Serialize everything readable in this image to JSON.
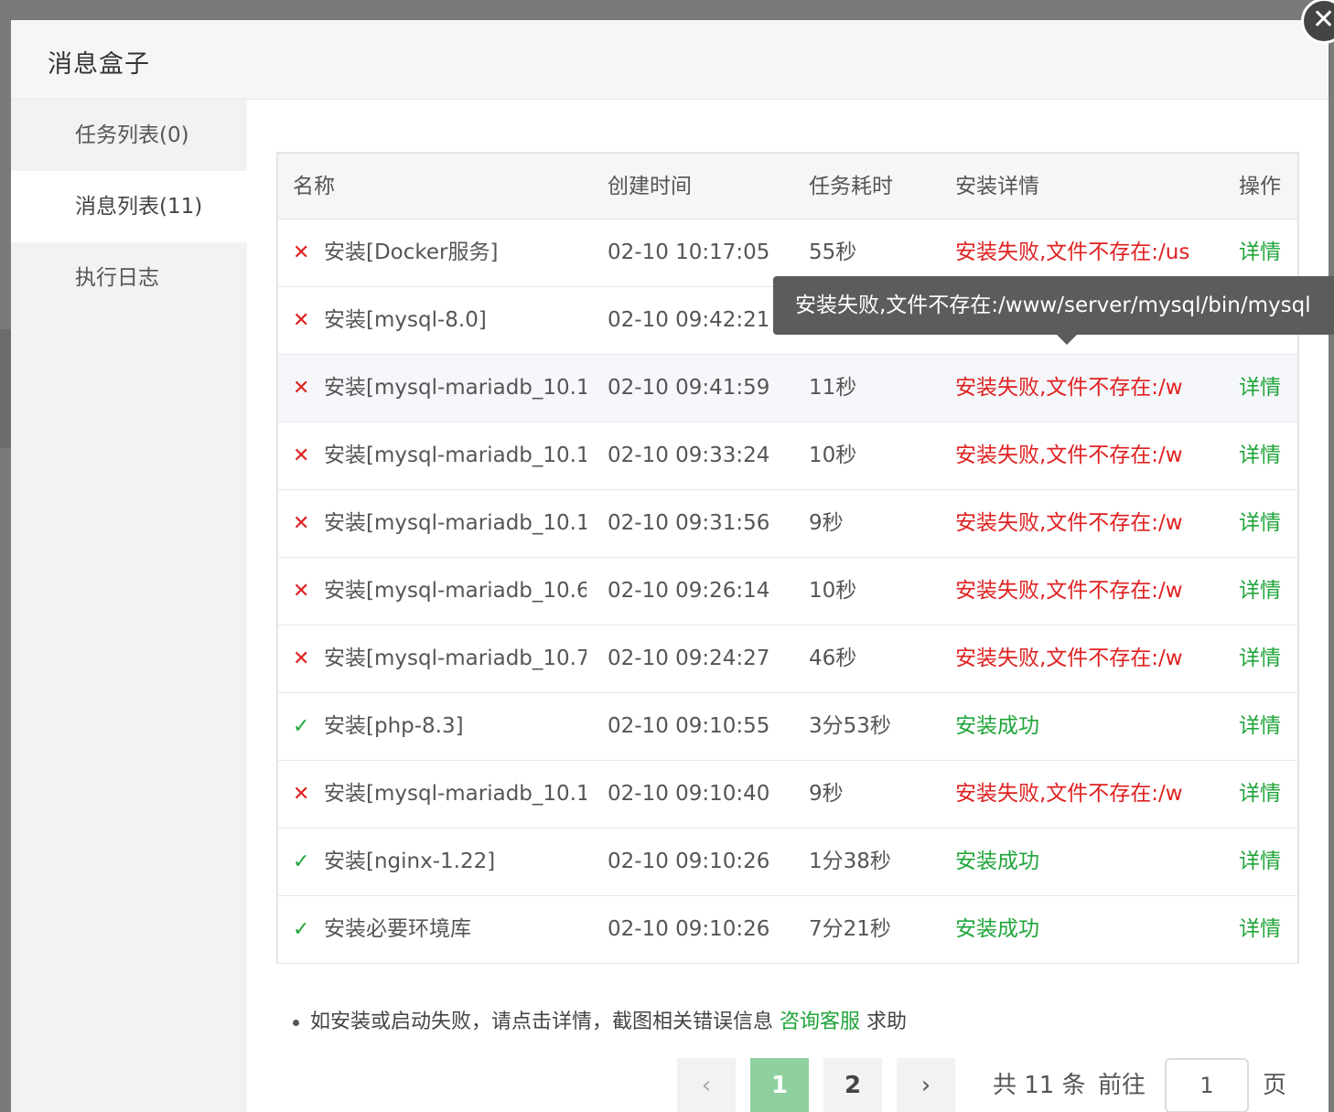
{
  "dialog": {
    "title": "消息盒子",
    "close_glyph": "✕"
  },
  "sidebar": {
    "items": [
      {
        "label": "任务列表(0)"
      },
      {
        "label": "消息列表(11)"
      },
      {
        "label": "执行日志"
      }
    ]
  },
  "table": {
    "headers": {
      "name": "名称",
      "time": "创建时间",
      "duration": "任务耗时",
      "detail": "安装详情",
      "op": "操作"
    },
    "rows": [
      {
        "status": "✕",
        "name": "安装[Docker服务]",
        "time": "02-10 10:17:05",
        "duration": "55秒",
        "detail": "安装失败,文件不存在:/us",
        "op": "详情"
      },
      {
        "status": "✕",
        "name": "安装[mysql-8.0]",
        "time": "02-10 09:42:21",
        "duration": "",
        "detail": "",
        "op": ""
      },
      {
        "status": "✕",
        "name": "安装[mysql-mariadb_10.1",
        "time": "02-10 09:41:59",
        "duration": "11秒",
        "detail": "安装失败,文件不存在:/w",
        "op": "详情"
      },
      {
        "status": "✕",
        "name": "安装[mysql-mariadb_10.1",
        "time": "02-10 09:33:24",
        "duration": "10秒",
        "detail": "安装失败,文件不存在:/w",
        "op": "详情"
      },
      {
        "status": "✕",
        "name": "安装[mysql-mariadb_10.1",
        "time": "02-10 09:31:56",
        "duration": "9秒",
        "detail": "安装失败,文件不存在:/w",
        "op": "详情"
      },
      {
        "status": "✕",
        "name": "安装[mysql-mariadb_10.6",
        "time": "02-10 09:26:14",
        "duration": "10秒",
        "detail": "安装失败,文件不存在:/w",
        "op": "详情"
      },
      {
        "status": "✕",
        "name": "安装[mysql-mariadb_10.7",
        "time": "02-10 09:24:27",
        "duration": "46秒",
        "detail": "安装失败,文件不存在:/w",
        "op": "详情"
      },
      {
        "status": "✓",
        "name": "安装[php-8.3]",
        "time": "02-10 09:10:55",
        "duration": "3分53秒",
        "detail": "安装成功",
        "op": "详情"
      },
      {
        "status": "✕",
        "name": "安装[mysql-mariadb_10.1",
        "time": "02-10 09:10:40",
        "duration": "9秒",
        "detail": "安装失败,文件不存在:/w",
        "op": "详情"
      },
      {
        "status": "✓",
        "name": "安装[nginx-1.22]",
        "time": "02-10 09:10:26",
        "duration": "1分38秒",
        "detail": "安装成功",
        "op": "详情"
      },
      {
        "status": "✓",
        "name": "安装必要环境库",
        "time": "02-10 09:10:26",
        "duration": "7分21秒",
        "detail": "安装成功",
        "op": "详情"
      }
    ]
  },
  "tooltip": {
    "text": "安装失败,文件不存在:/www/server/mysql/bin/mysql"
  },
  "note": {
    "text": "如安装或启动失败，请点击详情，截图相关错误信息",
    "link": "咨询客服",
    "suffix": "求助"
  },
  "pager": {
    "prev": "‹",
    "next": "›",
    "pages": [
      "1",
      "2"
    ],
    "total": "共 11 条",
    "goto": "前往",
    "current": "1",
    "page_unit": "页"
  },
  "colors": {
    "fail": "#e02020",
    "success": "#20a53a",
    "active_page": "#8fd19e"
  }
}
